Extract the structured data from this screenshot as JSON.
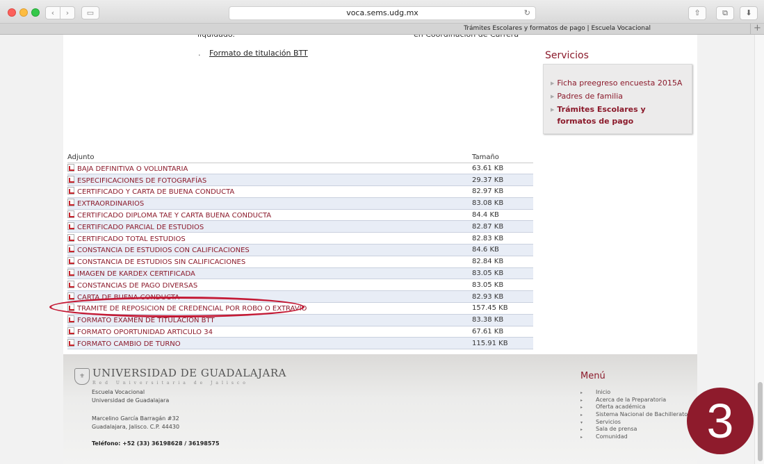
{
  "browser": {
    "url": "voca.sems.udg.mx",
    "tab_title": "Trámites Escolares y formatos de pago | Escuela Vocacional",
    "back": "‹",
    "forward": "›",
    "sidebar": "▭",
    "reload": "↻",
    "share": "⇧",
    "tabs": "⧉",
    "download": "⬇",
    "new_tab": "+"
  },
  "content": {
    "cut_left": "liquidado.",
    "cut_right": "en Coordinación de Carrera",
    "bullet": "·",
    "format_link": "Formato de titulación BTT"
  },
  "services": {
    "title": "Servicios",
    "items": [
      {
        "label": "Ficha preegreso encuesta 2015A"
      },
      {
        "label": "Padres de familia"
      },
      {
        "label": "Trámites Escolares y formatos de pago"
      }
    ]
  },
  "attachments": {
    "headers": {
      "name": "Adjunto",
      "size": "Tamaño"
    },
    "rows": [
      {
        "name": "BAJA DEFINITIVA O VOLUNTARIA",
        "size": "63.61 KB"
      },
      {
        "name": "ESPECIFICACIONES DE FOTOGRAFÍAS",
        "size": "29.37 KB"
      },
      {
        "name": "CERTIFICADO Y CARTA DE BUENA CONDUCTA",
        "size": "82.97 KB"
      },
      {
        "name": "EXTRAORDINARIOS",
        "size": "83.08 KB"
      },
      {
        "name": "CERTIFICADO DIPLOMA TAE Y CARTA BUENA CONDUCTA",
        "size": "84.4 KB"
      },
      {
        "name": "CERTIFICADO PARCIAL DE ESTUDIOS",
        "size": "82.87 KB"
      },
      {
        "name": "CERTIFICADO TOTAL ESTUDIOS",
        "size": "82.83 KB"
      },
      {
        "name": "CONSTANCIA DE ESTUDIOS CON CALIFICACIONES",
        "size": "84.6 KB"
      },
      {
        "name": "CONSTANCIA DE ESTUDIOS SIN CALIFICACIONES",
        "size": "82.84 KB"
      },
      {
        "name": "IMAGEN DE KARDEX CERTIFICADA",
        "size": "83.05 KB"
      },
      {
        "name": "CONSTANCIAS DE PAGO DIVERSAS",
        "size": "83.05 KB"
      },
      {
        "name": "CARTA DE BUENA CONDUCTA",
        "size": "82.93 KB"
      },
      {
        "name": "TRAMITE DE REPOSICION DE CREDENCIAL POR ROBO O EXTRAVIO",
        "size": "157.45 KB"
      },
      {
        "name": "FORMATO EXAMEN DE TITULACION BTT",
        "size": "83.38 KB"
      },
      {
        "name": "FORMATO OPORTUNIDAD ARTICULO 34",
        "size": "67.61 KB"
      },
      {
        "name": "FORMATO CAMBIO DE TURNO",
        "size": "115.91 KB"
      }
    ]
  },
  "footer": {
    "university": "UNIVERSIDAD DE GUADALAJARA",
    "network": "Red Universitaria de Jalisco",
    "school": "Escuela Vocacional",
    "university_line": "Universidad de Guadalajara",
    "address1": "Marcelino García Barragán #32",
    "address2": "Guadalajara, Jalisco. C.P. 44430",
    "phone": "Teléfono: +52 (33) 36198628 / 36198575",
    "menu_title": "Menú",
    "menu": [
      {
        "label": "Inicio",
        "arrow": "▸"
      },
      {
        "label": "Acerca de la Preparatoria",
        "arrow": "▸"
      },
      {
        "label": "Oferta académica",
        "arrow": "▸"
      },
      {
        "label": "Sistema Nacional de Bachillerato",
        "arrow": "▸"
      },
      {
        "label": "Servicios",
        "arrow": "▾"
      },
      {
        "label": "Sala de prensa",
        "arrow": "▸"
      },
      {
        "label": "Comunidad",
        "arrow": "▸"
      }
    ]
  },
  "badge": {
    "number": "3"
  },
  "colors": {
    "accent": "#8b1a2b",
    "annotation": "#c41a35",
    "badge": "#8e1b2c"
  }
}
